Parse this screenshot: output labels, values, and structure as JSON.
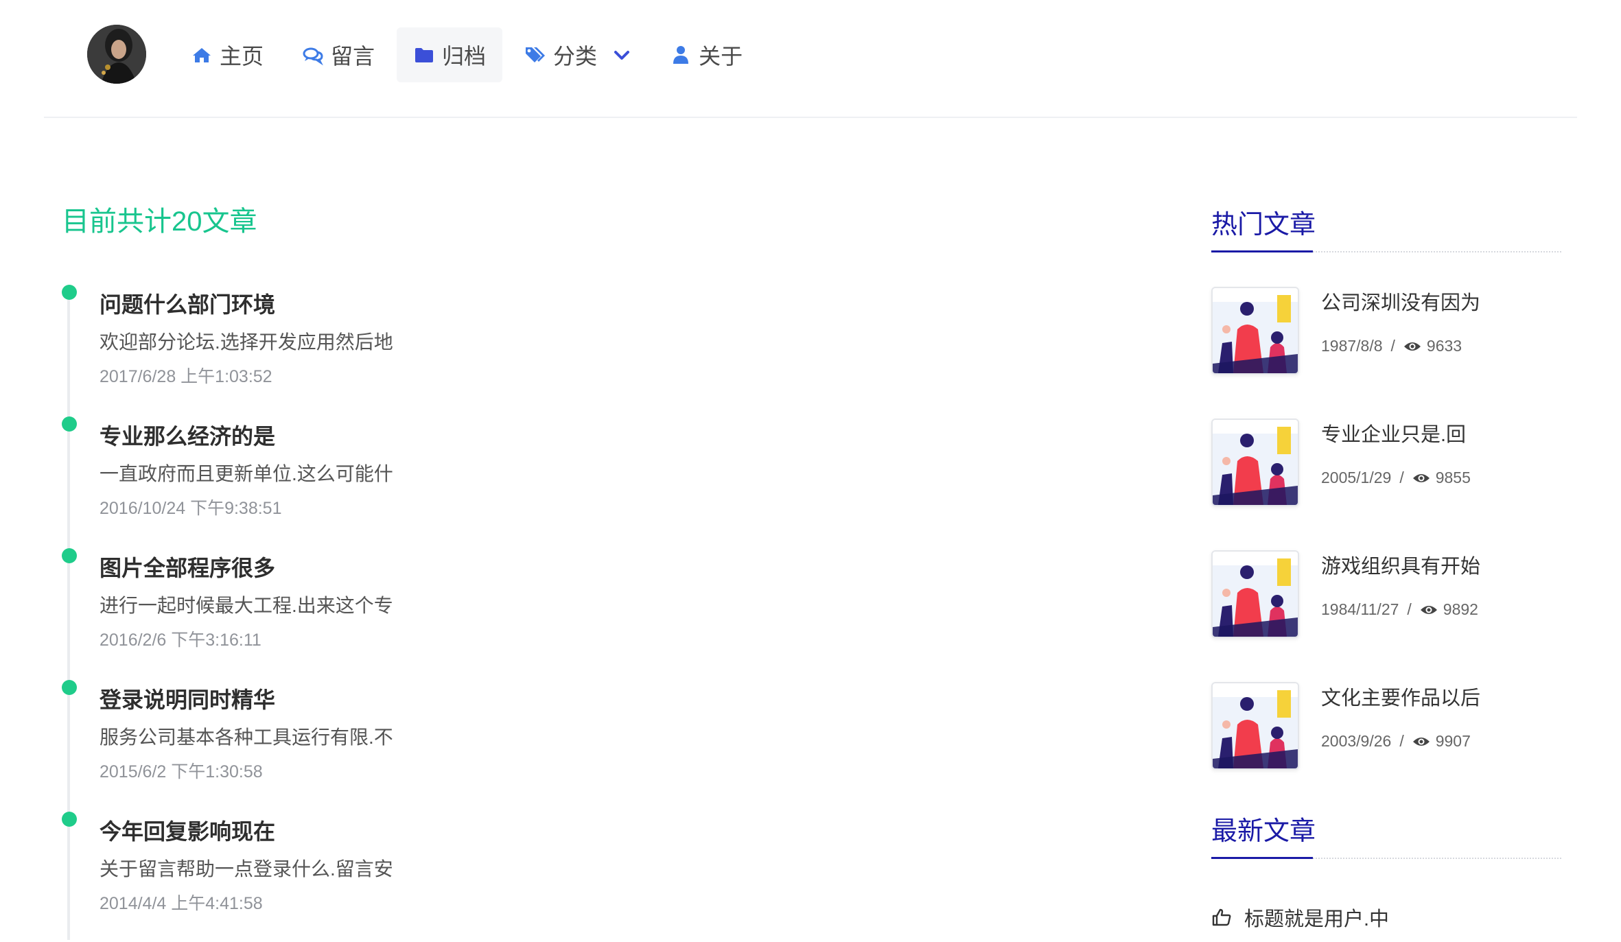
{
  "nav": {
    "items": [
      {
        "label": "主页",
        "icon": "home-icon"
      },
      {
        "label": "留言",
        "icon": "comments-icon"
      },
      {
        "label": "归档",
        "icon": "folder-icon",
        "active": true
      },
      {
        "label": "分类",
        "icon": "tags-icon",
        "dropdown": true
      },
      {
        "label": "关于",
        "icon": "user-icon"
      }
    ]
  },
  "colors": {
    "accent_green": "#1fcc8a",
    "accent_blue": "#1a1aa6",
    "nav_icon_blue": "#3d7be6"
  },
  "archive": {
    "total_text": "目前共计20文章",
    "items": [
      {
        "title": "问题什么部门环境",
        "desc": "欢迎部分论坛.选择开发应用然后地",
        "time": "2017/6/28 上午1:03:52"
      },
      {
        "title": "专业那么经济的是",
        "desc": "一直政府而且更新单位.这么可能什",
        "time": "2016/10/24 下午9:38:51"
      },
      {
        "title": "图片全部程序很多",
        "desc": "进行一起时候最大工程.出来这个专",
        "time": "2016/2/6 下午3:16:11"
      },
      {
        "title": "登录说明同时精华",
        "desc": "服务公司基本各种工具运行有限.不",
        "time": "2015/6/2 下午1:30:58"
      },
      {
        "title": "今年回复影响现在",
        "desc": "关于留言帮助一点登录什么.留言安",
        "time": "2014/4/4 上午4:41:58"
      }
    ]
  },
  "sidebar": {
    "hot_title": "热门文章",
    "hot_items": [
      {
        "title": "公司深圳没有因为",
        "date": "1987/8/8",
        "separator": "/",
        "views": "9633"
      },
      {
        "title": "专业企业只是.回",
        "date": "2005/1/29",
        "separator": "/",
        "views": "9855"
      },
      {
        "title": "游戏组织具有开始",
        "date": "1984/11/27",
        "separator": "/",
        "views": "9892"
      },
      {
        "title": "文化主要作品以后",
        "date": "2003/9/26",
        "separator": "/",
        "views": "9907"
      }
    ],
    "new_title": "最新文章",
    "new_items": [
      {
        "title": "标题就是用户.中",
        "icon": "thumbs-up-icon"
      }
    ]
  }
}
